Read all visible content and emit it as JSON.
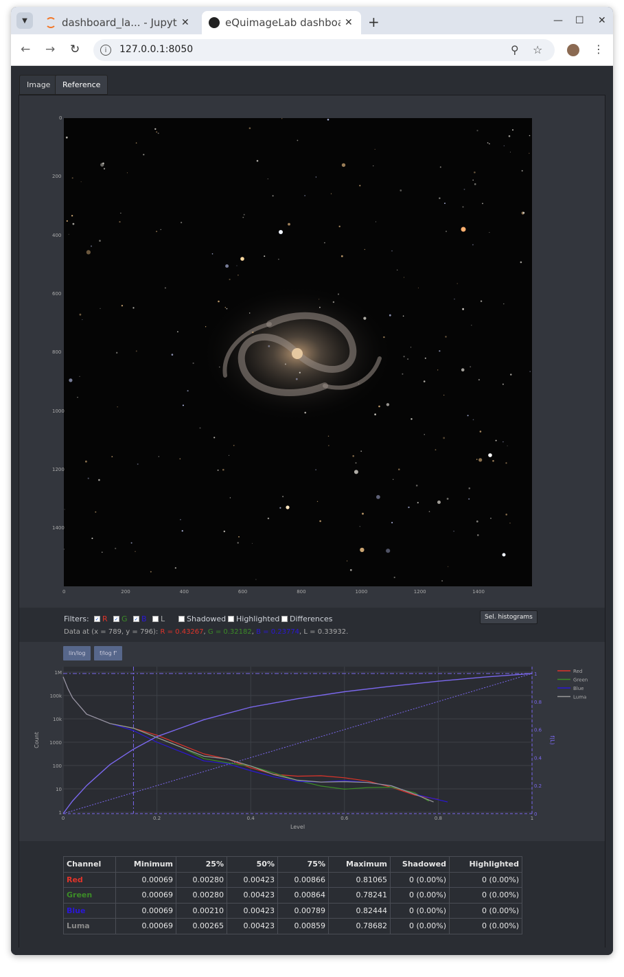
{
  "browser": {
    "tabs": [
      {
        "title": "dashboard_la... - Jupyter",
        "active": false
      },
      {
        "title": "eQuimageLab dashboard",
        "active": true
      }
    ],
    "url": "127.0.0.1:8050",
    "icons": [
      "back-icon",
      "forward-icon",
      "reload-icon",
      "site-info-icon",
      "zoom-icon",
      "bookmark-star-icon",
      "avatar",
      "menu-icon"
    ]
  },
  "app": {
    "tabs": [
      "Image",
      "Reference"
    ],
    "image_axes": {
      "x_ticks": [
        "0",
        "200",
        "400",
        "600",
        "800",
        "1000",
        "1200",
        "1400"
      ],
      "y_ticks": [
        "0",
        "200",
        "400",
        "600",
        "800",
        "1000",
        "1200",
        "1400"
      ]
    },
    "filters": {
      "label": "Filters:",
      "r": "R",
      "g": "G",
      "b": "B",
      "l": "L",
      "shadowed": "Shadowed",
      "highlighted": "Highlighted",
      "differences": "Differences",
      "r_checked": true,
      "g_checked": true,
      "b_checked": true,
      "l_checked": false,
      "sel_histograms": "Sel. histograms"
    },
    "data_at": {
      "prefix": "Data at (x = 789, y = 796): ",
      "r": "R = 0.43267",
      "g": "G = 0.32182",
      "b": "B = 0.23774",
      "l": "L = 0.33932."
    },
    "hist_buttons": [
      "lin/log",
      "f/log f'"
    ],
    "stats": {
      "headers": [
        "Channel",
        "Minimum",
        "25%",
        "50%",
        "75%",
        "Maximum",
        "Shadowed",
        "Highlighted"
      ],
      "rows": [
        {
          "channel": "Red",
          "color": "#e0342a",
          "values": [
            "0.00069",
            "0.00280",
            "0.00423",
            "0.00866",
            "0.81065",
            "0 (0.00%)",
            "0 (0.00%)"
          ]
        },
        {
          "channel": "Green",
          "color": "#3c8c27",
          "values": [
            "0.00069",
            "0.00280",
            "0.00423",
            "0.00864",
            "0.78241",
            "0 (0.00%)",
            "0 (0.00%)"
          ]
        },
        {
          "channel": "Blue",
          "color": "#2a17d6",
          "values": [
            "0.00069",
            "0.00210",
            "0.00423",
            "0.00789",
            "0.82444",
            "0 (0.00%)",
            "0 (0.00%)"
          ]
        },
        {
          "channel": "Luma",
          "color": "#8a8a8a",
          "values": [
            "0.00069",
            "0.00265",
            "0.00423",
            "0.00859",
            "0.78682",
            "0 (0.00%)",
            "0 (0.00%)"
          ]
        }
      ]
    }
  },
  "chart_data": {
    "type": "line",
    "xlabel": "Level",
    "ylabel": "Count",
    "y2label": "f(L)",
    "xlim": [
      0,
      1
    ],
    "ylim_log": [
      1,
      1000000
    ],
    "y2lim": [
      0,
      1
    ],
    "x_ticks": [
      "0",
      "0.2",
      "0.4",
      "0.6",
      "0.8",
      "1"
    ],
    "y_ticks": [
      "1",
      "10",
      "100",
      "1000",
      "10k",
      "100k",
      "1M"
    ],
    "y2_ticks": [
      "0",
      "0.2",
      "0.4",
      "0.6",
      "0.8",
      "1"
    ],
    "legend": [
      "Red",
      "Green",
      "Blue",
      "Luma"
    ],
    "legend_position": "right",
    "vline_x": 0.15,
    "colors": {
      "Red": "#e0342a",
      "Green": "#3c8c27",
      "Blue": "#2a17d6",
      "Luma": "#9a9a9a",
      "fL": "#7b68ee"
    },
    "series": [
      {
        "name": "Red",
        "x": [
          0,
          0.01,
          0.02,
          0.05,
          0.1,
          0.15,
          0.2,
          0.25,
          0.3,
          0.35,
          0.4,
          0.45,
          0.5,
          0.55,
          0.6,
          0.65,
          0.7,
          0.75,
          0.8
        ],
        "log10y": [
          5.8,
          5.3,
          4.9,
          4.2,
          3.8,
          3.6,
          3.3,
          2.9,
          2.5,
          2.2,
          2.0,
          1.8,
          1.65,
          1.5,
          1.3,
          1.2,
          1.1,
          0.9,
          0.7
        ]
      },
      {
        "name": "Green",
        "x": [
          0,
          0.01,
          0.02,
          0.05,
          0.1,
          0.15,
          0.2,
          0.25,
          0.3,
          0.35,
          0.4,
          0.45,
          0.5,
          0.55,
          0.6,
          0.65,
          0.7,
          0.75,
          0.78
        ],
        "log10y": [
          5.8,
          5.3,
          4.9,
          4.2,
          3.8,
          3.6,
          3.2,
          2.8,
          2.3,
          2.0,
          1.8,
          1.6,
          1.45,
          1.3,
          1.1,
          1.0,
          0.9,
          0.7,
          0.5
        ]
      },
      {
        "name": "Blue",
        "x": [
          0,
          0.01,
          0.02,
          0.05,
          0.1,
          0.15,
          0.2,
          0.25,
          0.3,
          0.35,
          0.4,
          0.45,
          0.5,
          0.55,
          0.6,
          0.65,
          0.7,
          0.75,
          0.82
        ],
        "log10y": [
          5.8,
          5.3,
          4.9,
          4.2,
          3.8,
          3.5,
          3.0,
          2.6,
          2.2,
          1.9,
          1.7,
          1.6,
          1.5,
          1.4,
          1.3,
          1.1,
          1.0,
          0.8,
          0.6
        ]
      },
      {
        "name": "Luma",
        "x": [
          0,
          0.01,
          0.02,
          0.05,
          0.1,
          0.15,
          0.2,
          0.25,
          0.3,
          0.35,
          0.4,
          0.45,
          0.5,
          0.55,
          0.6,
          0.65,
          0.7,
          0.75,
          0.79
        ],
        "log10y": [
          5.8,
          5.3,
          4.9,
          4.2,
          3.8,
          3.6,
          3.2,
          2.8,
          2.4,
          2.1,
          1.9,
          1.7,
          1.55,
          1.4,
          1.25,
          1.1,
          1.0,
          0.8,
          0.6
        ]
      }
    ],
    "fL": {
      "x": [
        0,
        0.02,
        0.05,
        0.1,
        0.15,
        0.2,
        0.3,
        0.4,
        0.5,
        0.6,
        0.7,
        0.8,
        0.9,
        1
      ],
      "y": [
        0,
        0.09,
        0.2,
        0.35,
        0.46,
        0.55,
        0.67,
        0.76,
        0.82,
        0.87,
        0.91,
        0.945,
        0.975,
        1
      ]
    }
  }
}
